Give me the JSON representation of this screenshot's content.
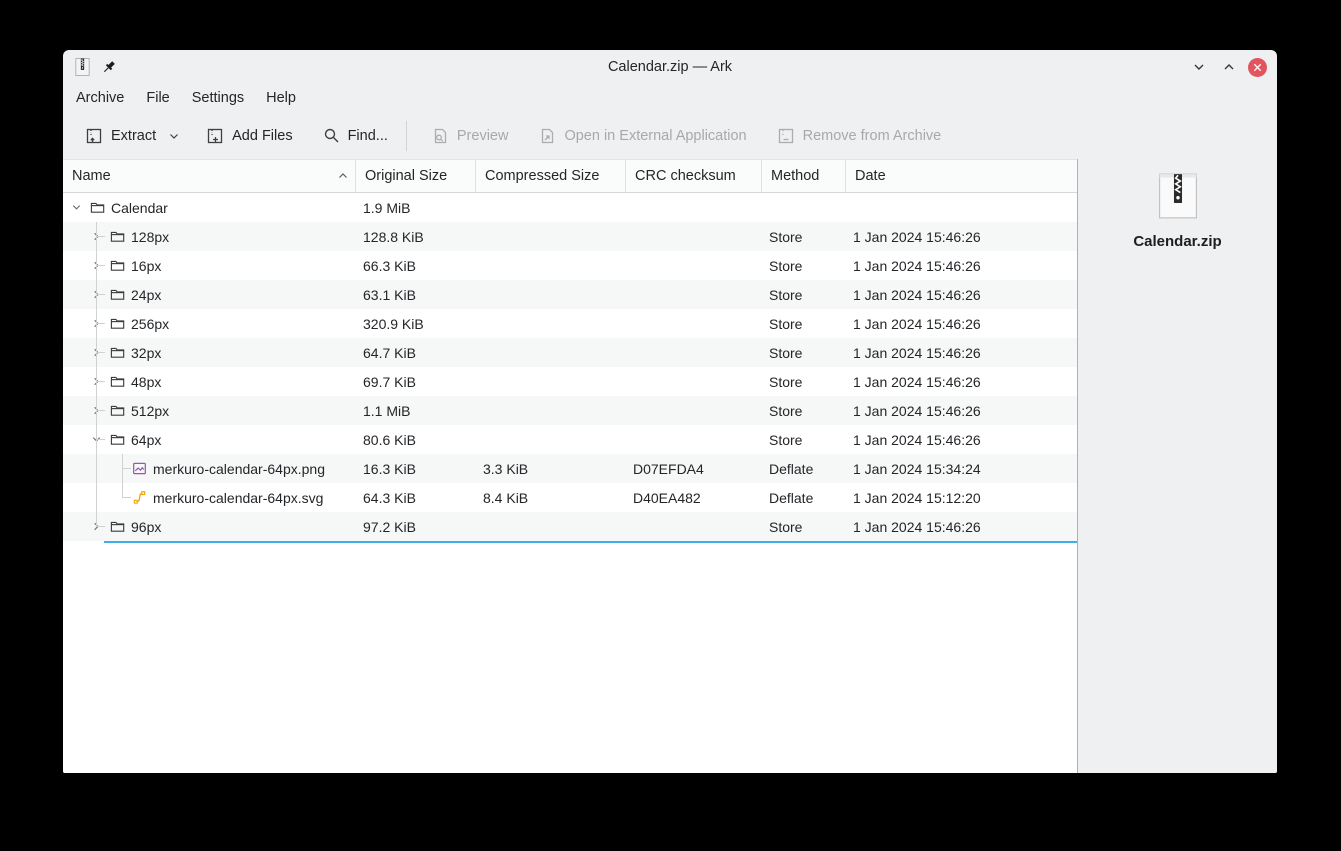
{
  "window": {
    "title": "Calendar.zip — Ark"
  },
  "menu": {
    "items": [
      "Archive",
      "File",
      "Settings",
      "Help"
    ]
  },
  "toolbar": {
    "extract_label": "Extract",
    "add_files_label": "Add Files",
    "find_label": "Find...",
    "preview_label": "Preview",
    "open_external_label": "Open in External Application",
    "remove_label": "Remove from Archive"
  },
  "table": {
    "columns": [
      "Name",
      "Original Size",
      "Compressed Size",
      "CRC checksum",
      "Method",
      "Date"
    ],
    "sort_column": "Name",
    "sort_direction": "ascending",
    "rows": [
      {
        "name": "Calendar",
        "original_size": "1.9 MiB",
        "compressed_size": "",
        "crc": "",
        "method": "",
        "date": "",
        "level": 0,
        "icon": "folder",
        "chevron": "down"
      },
      {
        "name": "128px",
        "original_size": "128.8 KiB",
        "compressed_size": "",
        "crc": "",
        "method": "Store",
        "date": "1 Jan 2024 15:46:26",
        "level": 1,
        "icon": "folder",
        "chevron": "right"
      },
      {
        "name": "16px",
        "original_size": "66.3 KiB",
        "compressed_size": "",
        "crc": "",
        "method": "Store",
        "date": "1 Jan 2024 15:46:26",
        "level": 1,
        "icon": "folder",
        "chevron": "right"
      },
      {
        "name": "24px",
        "original_size": "63.1 KiB",
        "compressed_size": "",
        "crc": "",
        "method": "Store",
        "date": "1 Jan 2024 15:46:26",
        "level": 1,
        "icon": "folder",
        "chevron": "right"
      },
      {
        "name": "256px",
        "original_size": "320.9 KiB",
        "compressed_size": "",
        "crc": "",
        "method": "Store",
        "date": "1 Jan 2024 15:46:26",
        "level": 1,
        "icon": "folder",
        "chevron": "right"
      },
      {
        "name": "32px",
        "original_size": "64.7 KiB",
        "compressed_size": "",
        "crc": "",
        "method": "Store",
        "date": "1 Jan 2024 15:46:26",
        "level": 1,
        "icon": "folder",
        "chevron": "right"
      },
      {
        "name": "48px",
        "original_size": "69.7 KiB",
        "compressed_size": "",
        "crc": "",
        "method": "Store",
        "date": "1 Jan 2024 15:46:26",
        "level": 1,
        "icon": "folder",
        "chevron": "right"
      },
      {
        "name": "512px",
        "original_size": "1.1 MiB",
        "compressed_size": "",
        "crc": "",
        "method": "Store",
        "date": "1 Jan 2024 15:46:26",
        "level": 1,
        "icon": "folder",
        "chevron": "right"
      },
      {
        "name": "64px",
        "original_size": "80.6 KiB",
        "compressed_size": "",
        "crc": "",
        "method": "Store",
        "date": "1 Jan 2024 15:46:26",
        "level": 1,
        "icon": "folder",
        "chevron": "down"
      },
      {
        "name": "merkuro-calendar-64px.png",
        "original_size": "16.3 KiB",
        "compressed_size": "3.3 KiB",
        "crc": "D07EFDA4",
        "method": "Deflate",
        "date": "1 Jan 2024 15:34:24",
        "level": 2,
        "icon": "image",
        "chevron": null
      },
      {
        "name": "merkuro-calendar-64px.svg",
        "original_size": "64.3 KiB",
        "compressed_size": "8.4 KiB",
        "crc": "D40EA482",
        "method": "Deflate",
        "date": "1 Jan 2024 15:12:20",
        "level": 2,
        "icon": "svg",
        "chevron": null
      },
      {
        "name": "96px",
        "original_size": "97.2 KiB",
        "compressed_size": "",
        "crc": "",
        "method": "Store",
        "date": "1 Jan 2024 15:46:26",
        "level": 1,
        "icon": "folder",
        "chevron": "right"
      }
    ]
  },
  "side_panel": {
    "file_name": "Calendar.zip"
  },
  "colors": {
    "accent": "#3daee9",
    "close_button": "#e25560",
    "stripe": "#f6f7f7"
  }
}
